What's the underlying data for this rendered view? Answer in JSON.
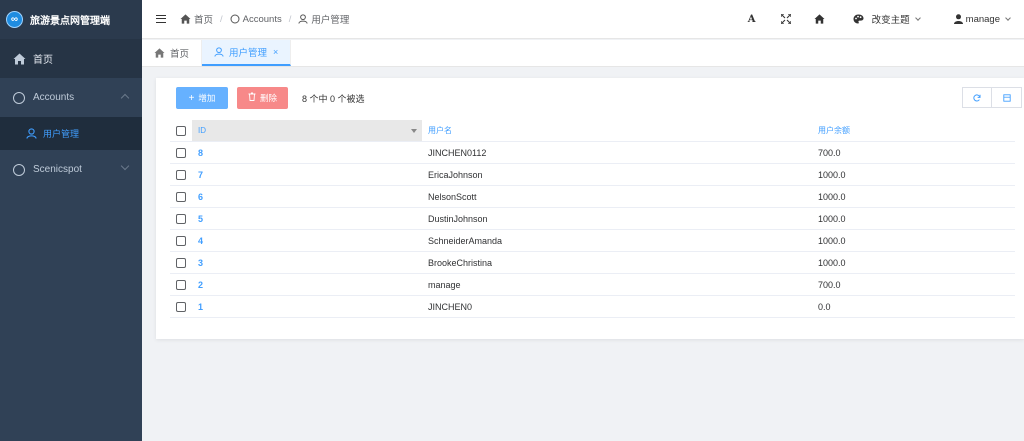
{
  "app": {
    "title": "旅游景点网管理端",
    "logo_glyph": "∞"
  },
  "sidebar": {
    "home_label": "首页",
    "accounts_label": "Accounts",
    "user_mgmt_label": "用户管理",
    "scenic_label": "Scenicspot"
  },
  "topbar": {
    "breadcrumb": {
      "home": "首页",
      "accounts": "Accounts",
      "current": "用户管理"
    },
    "font_icon_label": "A",
    "theme_label": "改变主题",
    "user_label": "manage"
  },
  "tabs": [
    {
      "label": "首页"
    },
    {
      "label": "用户管理",
      "close": "×"
    }
  ],
  "toolbar": {
    "add_label": "增加",
    "delete_label": "删除",
    "selection_info": "8 个中 0 个被选"
  },
  "table": {
    "headers": {
      "id": "ID",
      "username": "用户名",
      "balance": "用户余额"
    },
    "rows": [
      {
        "id": "8",
        "username": "JINCHEN0112",
        "balance": "700.0"
      },
      {
        "id": "7",
        "username": "EricaJohnson",
        "balance": "1000.0"
      },
      {
        "id": "6",
        "username": "NelsonScott",
        "balance": "1000.0"
      },
      {
        "id": "5",
        "username": "DustinJohnson",
        "balance": "1000.0"
      },
      {
        "id": "4",
        "username": "SchneiderAmanda",
        "balance": "1000.0"
      },
      {
        "id": "3",
        "username": "BrookeChristina",
        "balance": "1000.0"
      },
      {
        "id": "2",
        "username": "manage",
        "balance": "700.0"
      },
      {
        "id": "1",
        "username": "JINCHEN0",
        "balance": "0.0"
      }
    ]
  },
  "colors": {
    "sidebar": "#304156",
    "accent": "#409eff",
    "add_button": "#66b1ff",
    "delete_button": "#f78989"
  }
}
